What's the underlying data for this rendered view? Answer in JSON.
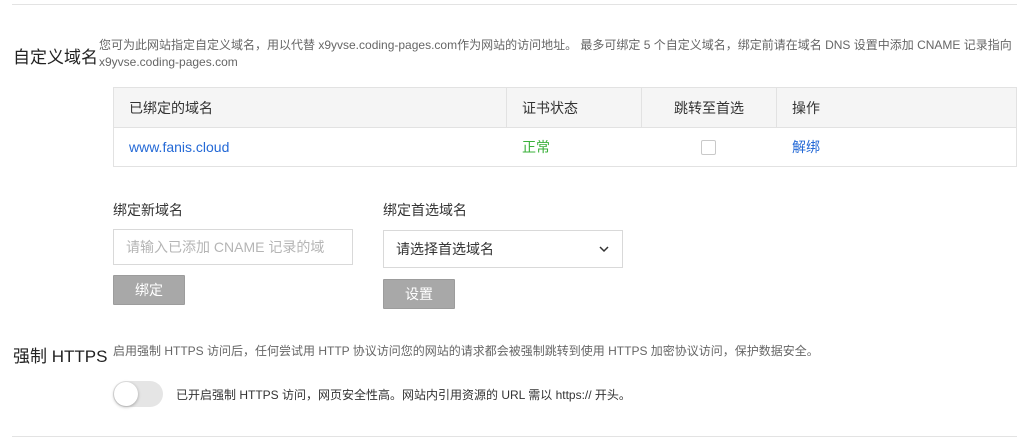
{
  "custom_domain": {
    "title": "自定义域名",
    "description": "您可为此网站指定自定义域名，用以代替 x9yvse.coding-pages.com作为网站的访问地址。 最多可绑定 5 个自定义域名，绑定前请在域名 DNS 设置中添加 CNAME 记录指向 x9yvse.coding-pages.com",
    "table": {
      "headers": [
        "已绑定的域名",
        "证书状态",
        "跳转至首选",
        "操作"
      ],
      "rows": [
        {
          "domain": "www.fanis.cloud",
          "cert_status": "正常",
          "redirect_checked": false,
          "action": "解绑"
        }
      ]
    },
    "bind_new": {
      "label": "绑定新域名",
      "placeholder": "请输入已添加 CNAME 记录的域",
      "value": "",
      "button": "绑定"
    },
    "preferred": {
      "label": "绑定首选域名",
      "selected": "请选择首选域名",
      "button": "设置"
    }
  },
  "https": {
    "title": "强制 HTTPS",
    "description": "启用强制 HTTPS 访问后，任何尝试用 HTTP 协议访问您的网站的请求都会被强制跳转到使用 HTTPS 加密协议访问，保护数据安全。",
    "toggle_on": false,
    "toggle_text": "已开启强制 HTTPS 访问，网页安全性高。网站内引用资源的 URL 需以 https:// 开头。"
  }
}
